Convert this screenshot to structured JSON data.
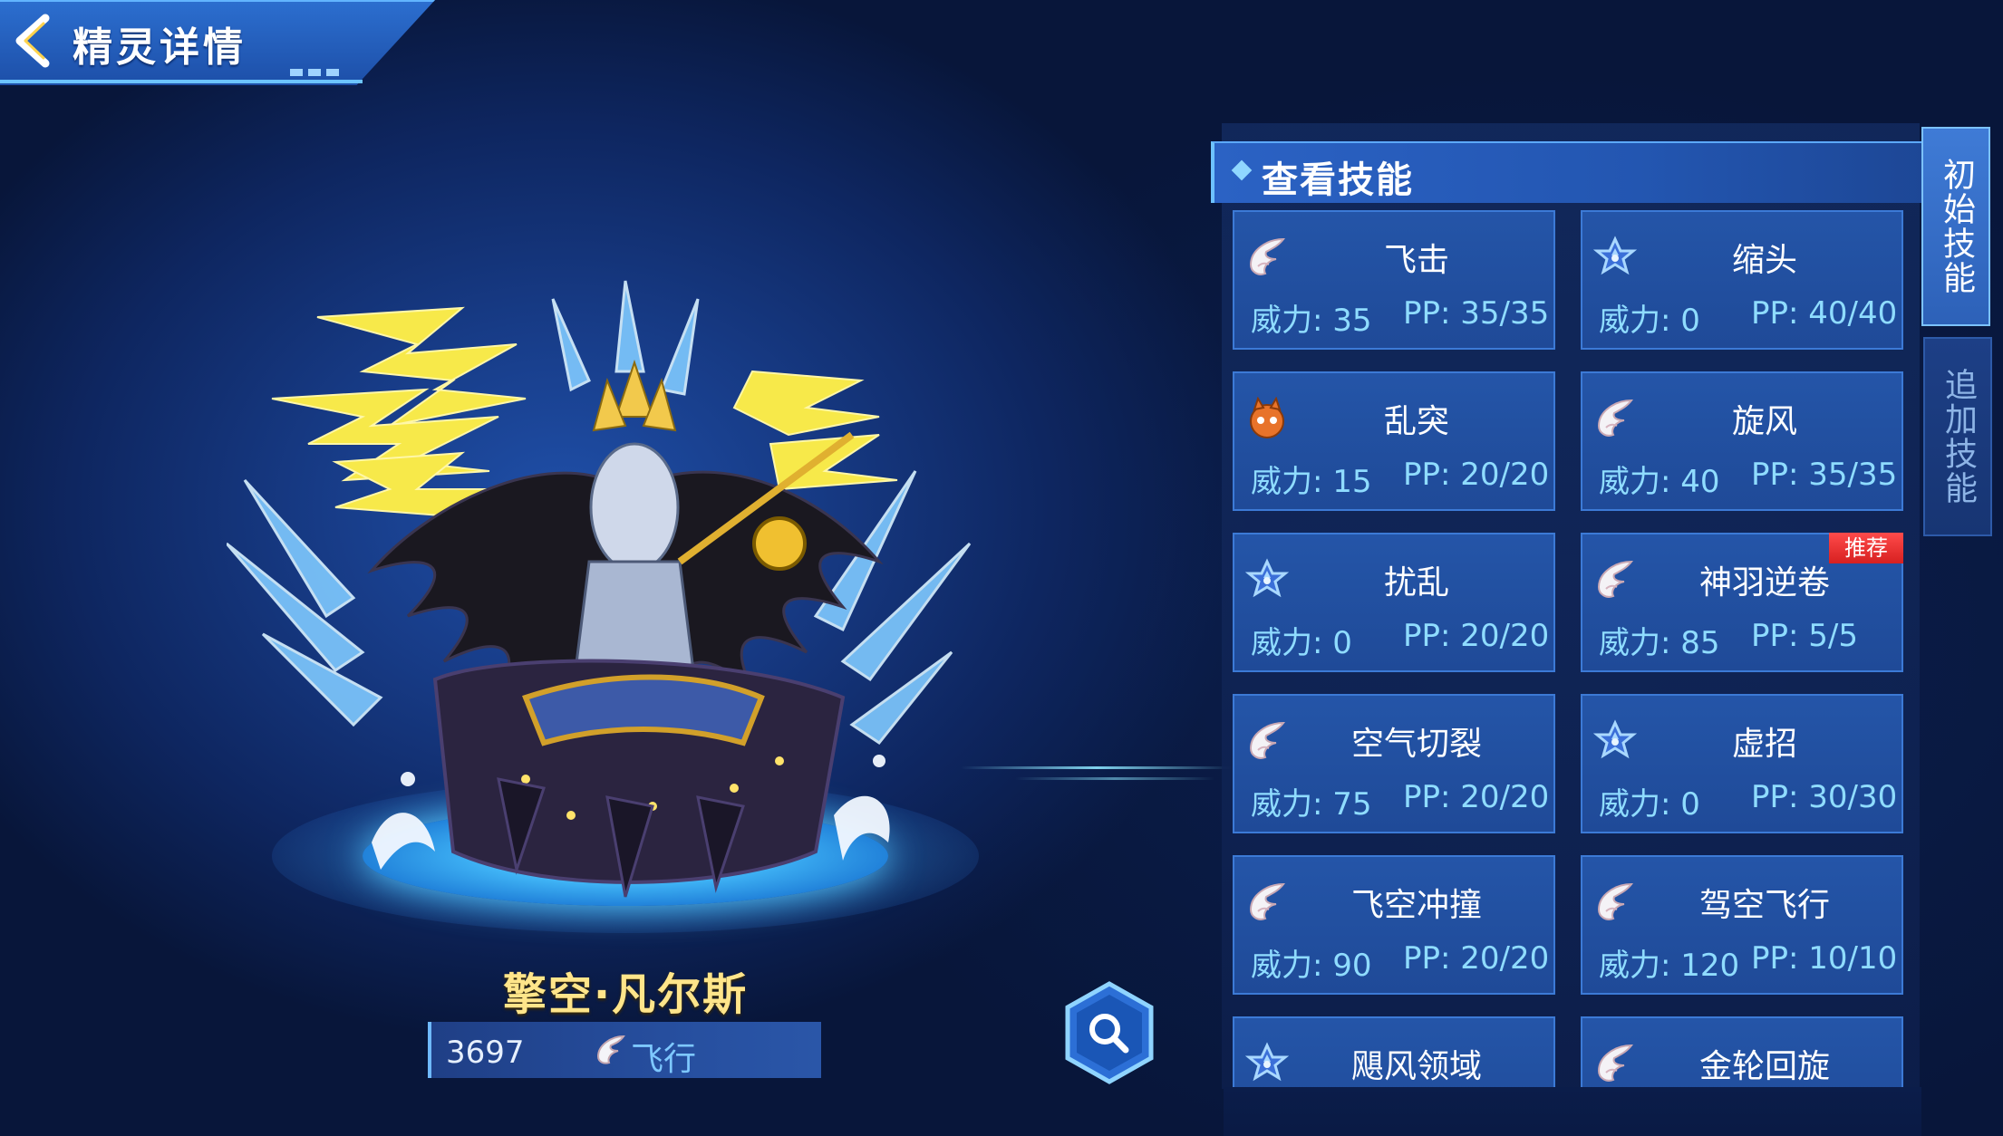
{
  "header": {
    "title": "精灵详情"
  },
  "pet": {
    "name": "擎空·凡尔斯",
    "id": "3697",
    "type_label": "飞行",
    "type_icon": "wing-icon"
  },
  "skills_panel": {
    "title": "查看技能",
    "tabs": {
      "initial": "初始技能",
      "added": "追加技能"
    },
    "selected_tab": "初始技能",
    "skills": [
      {
        "name": "飞击",
        "power": "威力: 35",
        "pp": "PP: 35/35",
        "icon": "wing-icon"
      },
      {
        "name": "缩头",
        "power": "威力: 0",
        "pp": "PP: 40/40",
        "icon": "star-icon"
      },
      {
        "name": "乱突",
        "power": "威力: 15",
        "pp": "PP: 20/20",
        "icon": "beast-icon"
      },
      {
        "name": "旋风",
        "power": "威力: 40",
        "pp": "PP: 35/35",
        "icon": "wing-icon"
      },
      {
        "name": "扰乱",
        "power": "威力: 0",
        "pp": "PP: 20/20",
        "icon": "star-icon"
      },
      {
        "name": "神羽逆卷",
        "power": "威力: 85",
        "pp": "PP: 5/5",
        "icon": "wing-icon",
        "badge": "推荐"
      },
      {
        "name": "空气切裂",
        "power": "威力: 75",
        "pp": "PP: 20/20",
        "icon": "wing-icon"
      },
      {
        "name": "虚招",
        "power": "威力: 0",
        "pp": "PP: 30/30",
        "icon": "star-icon"
      },
      {
        "name": "飞空冲撞",
        "power": "威力: 90",
        "pp": "PP: 20/20",
        "icon": "wing-icon"
      },
      {
        "name": "驾空飞行",
        "power": "威力: 120",
        "pp": "PP: 10/10",
        "icon": "wing-icon"
      },
      {
        "name": "飓风领域",
        "icon": "star-icon"
      },
      {
        "name": "金轮回旋",
        "icon": "wing-icon"
      }
    ]
  },
  "colors": {
    "pet_name": "#ffe58a",
    "stat_text": "#8fdcff",
    "badge": "#d72020",
    "type_text": "#7ec8ff"
  }
}
